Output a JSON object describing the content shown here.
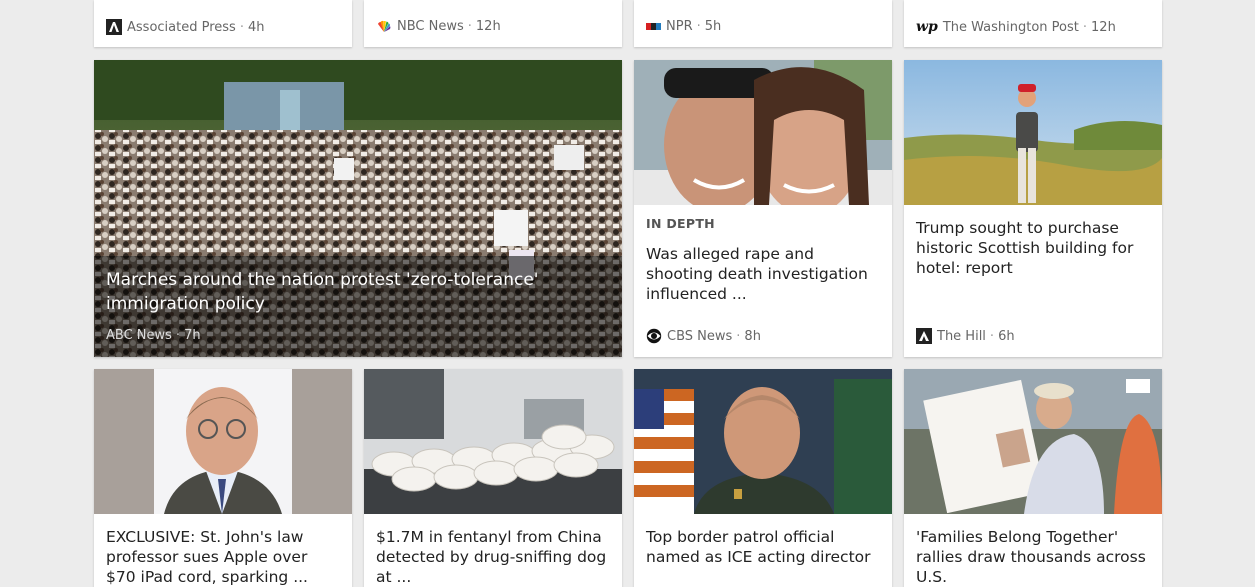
{
  "top_row": [
    {
      "source": "Associated Press",
      "age": "4h",
      "logo": "ap-logo-icon"
    },
    {
      "source": "NBC News",
      "age": "12h",
      "logo": "nbc-peacock-icon"
    },
    {
      "source": "NPR",
      "age": "5h",
      "logo": "npr-logo-icon"
    },
    {
      "source": "The Washington Post",
      "age": "12h",
      "logo": "wp-logo-icon"
    }
  ],
  "featured": {
    "title": "Marches around the nation protest 'zero-tolerance' immigration policy",
    "source": "ABC News",
    "age": "7h"
  },
  "mid_row": [
    {
      "kicker": "IN DEPTH",
      "title": "Was alleged rape and shooting death investigation influenced ...",
      "source": "CBS News",
      "age": "8h",
      "logo": "cbs-eye-icon"
    },
    {
      "title": "Trump sought to purchase historic Scottish building for hotel: report",
      "source": "The Hill",
      "age": "6h",
      "logo": "the-hill-logo-icon"
    }
  ],
  "bottom_row": [
    {
      "title": "EXCLUSIVE: St. John's law professor sues Apple over $70 iPad cord, sparking ..."
    },
    {
      "title": "$1.7M in fentanyl from China detected by drug-sniffing dog at ..."
    },
    {
      "title": "Top border patrol official named as ICE acting director"
    },
    {
      "title": "'Families Belong Together' rallies draw thousands across U.S."
    }
  ],
  "separator": "·"
}
